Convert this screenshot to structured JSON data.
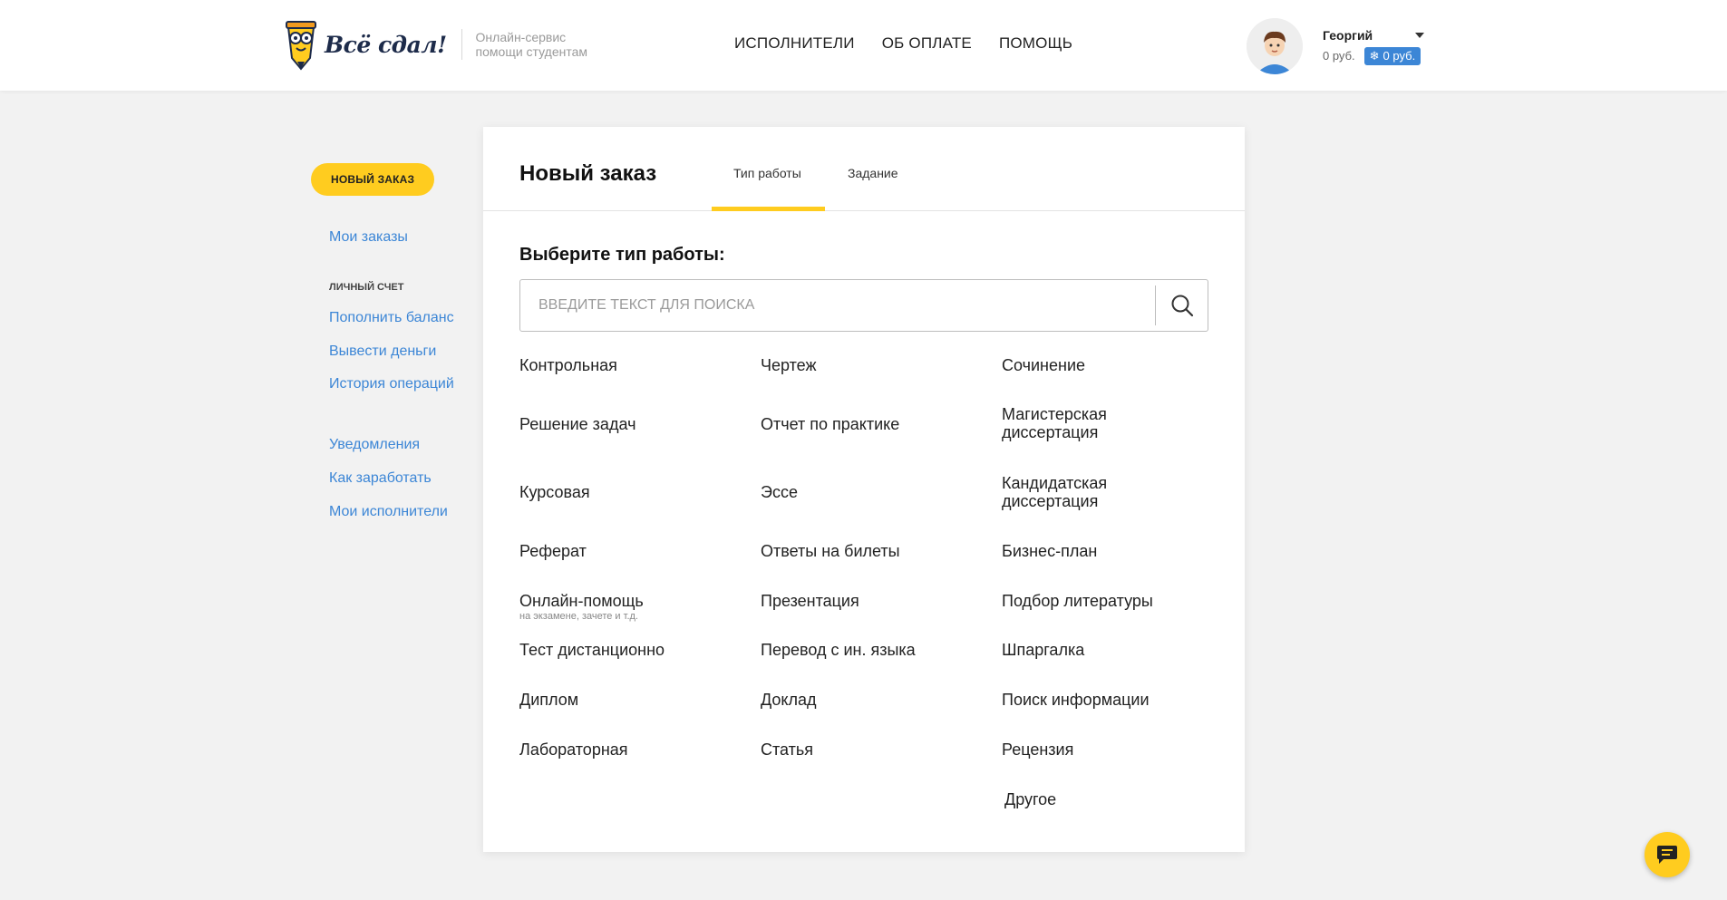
{
  "header": {
    "logo_text": "Всё сдал!",
    "tagline_line1": "Онлайн-сервис",
    "tagline_line2": "помощи студентам",
    "nav": [
      {
        "label": "ИСПОЛНИТЕЛИ"
      },
      {
        "label": "ОБ ОПЛАТЕ"
      },
      {
        "label": "ПОМОЩЬ"
      }
    ],
    "user": {
      "name": "Георгий",
      "balance": "0 руб.",
      "bonus_balance": "0 руб.",
      "bonus_icon": "snowflake-icon"
    }
  },
  "sidebar": {
    "new_order": "НОВЫЙ ЗАКАЗ",
    "my_orders": "Мои заказы",
    "account_heading": "ЛИЧНЫЙ СЧЕТ",
    "top_up": "Пополнить баланс",
    "withdraw": "Вывести деньги",
    "history": "История операций",
    "notifications": "Уведомления",
    "earn": "Как заработать",
    "my_executors": "Мои исполнители"
  },
  "main": {
    "title": "Новый заказ",
    "tabs": [
      {
        "label": "Тип работы",
        "active": true
      },
      {
        "label": "Задание",
        "active": false
      }
    ],
    "section_title": "Выберите тип работы:",
    "search_placeholder": "ВВЕДИТЕ ТЕКСТ ДЛЯ ПОИСКА",
    "work_types": {
      "col1": [
        "Контрольная",
        "Решение задач",
        "Курсовая",
        "Реферат",
        "Онлайн-помощь",
        "Тест дистанционно",
        "Диплом",
        "Лабораторная"
      ],
      "col1_sub": "на экзамене, зачете и т.д.",
      "col2": [
        "Чертеж",
        "Отчет по практике",
        "Эссе",
        "Ответы на билеты",
        "Презентация",
        "Перевод с ин. языка",
        "Доклад",
        "Статья"
      ],
      "col3": [
        "Сочинение",
        "Магистерская диссертация",
        "Кандидатская диссертация",
        "Бизнес-план",
        "Подбор литературы",
        "Шпаргалка",
        "Поиск информации",
        "Рецензия",
        "Другое"
      ]
    }
  },
  "colors": {
    "accent": "#ffcc1f",
    "link": "#3c86d6",
    "background": "#f2f2f2"
  }
}
